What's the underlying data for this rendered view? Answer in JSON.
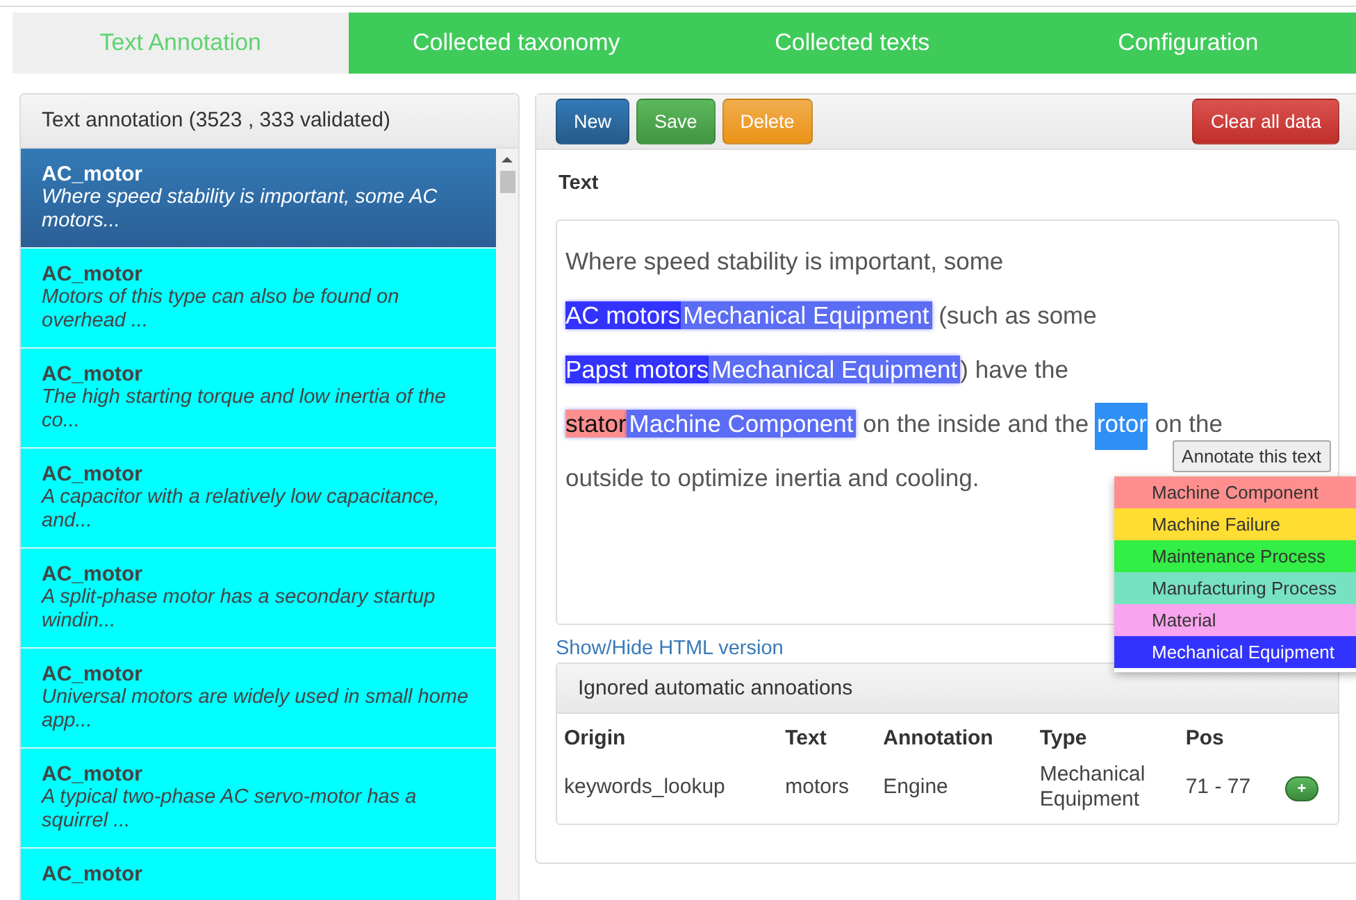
{
  "tabs": [
    {
      "label": "Text Annotation",
      "selected": true
    },
    {
      "label": "Collected taxonomy",
      "selected": false
    },
    {
      "label": "Collected texts",
      "selected": false
    },
    {
      "label": "Configuration",
      "selected": false
    }
  ],
  "list": {
    "title": "Text annotation (3523 , 333 validated)",
    "items": [
      {
        "name": "AC_motor",
        "snippet": "Where speed stability is important, some AC motors...",
        "selected": true
      },
      {
        "name": "AC_motor",
        "snippet": "Motors of this type can also be found on overhead ...",
        "selected": false
      },
      {
        "name": "AC_motor",
        "snippet": "The high starting torque and low inertia of the co...",
        "selected": false
      },
      {
        "name": "AC_motor",
        "snippet": "A capacitor with a relatively low capacitance, and...",
        "selected": false
      },
      {
        "name": "AC_motor",
        "snippet": "A split-phase motor has a secondary startup windin...",
        "selected": false
      },
      {
        "name": "AC_motor",
        "snippet": "Universal motors are widely used in small home app...",
        "selected": false
      },
      {
        "name": "AC_motor",
        "snippet": "A typical two-phase AC servo-motor has a squirrel ...",
        "selected": false
      },
      {
        "name": "AC_motor",
        "selected": false
      }
    ]
  },
  "toolbar": {
    "buttons": [
      {
        "label": "New",
        "kind": "primary"
      },
      {
        "label": "Save",
        "kind": "success"
      },
      {
        "label": "Delete",
        "kind": "warning"
      }
    ],
    "clear_button": "Clear all data"
  },
  "text_label": "Text",
  "segments": [
    {
      "kind": "plain",
      "text": "Where speed stability is important, some "
    },
    {
      "kind": "entity",
      "text": "AC motors",
      "label": "Mechanical Equipment",
      "color": "#3333ff"
    },
    {
      "kind": "plain",
      "text": " (such as some "
    },
    {
      "kind": "entity",
      "text": "Papst motors",
      "label": "Mechanical Equipment",
      "color": "#3333ff"
    },
    {
      "kind": "plain",
      "text": ") have the "
    },
    {
      "kind": "entity",
      "text": "stator",
      "label": "Machine Component",
      "color": "#ff8f8f"
    },
    {
      "kind": "plain",
      "text": " on the inside and the "
    },
    {
      "kind": "selection",
      "text": "rotor"
    },
    {
      "kind": "plain",
      "text": " on the"
    },
    {
      "kind": "plain",
      "text": " outside to optimize inertia and cooling."
    }
  ],
  "annotate_button": "Annotate this text",
  "categories": [
    {
      "label": "Machine Component",
      "color": "#ff8f8f"
    },
    {
      "label": "Machine Failure",
      "color": "#ffdd33"
    },
    {
      "label": "Maintenance Process",
      "color": "#33ee44"
    },
    {
      "label": "Manufacturing Process",
      "color": "#77e2c2"
    },
    {
      "label": "Material",
      "color": "#f8a4ee"
    },
    {
      "label": "Mechanical Equipment",
      "color": "#3333ff"
    }
  ],
  "html_link": "Show/Hide HTML version",
  "ignored": {
    "title": "Ignored automatic annoations",
    "columns": [
      "Origin",
      "Text",
      "Annotation",
      "Type",
      "Pos"
    ],
    "rows": [
      {
        "cells": [
          "keywords_lookup",
          "motors",
          "Engine",
          "Mechanical Equipment",
          "71 - 77"
        ],
        "action": "+"
      }
    ]
  }
}
